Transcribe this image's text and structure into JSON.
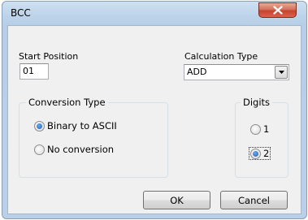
{
  "window": {
    "title": "BCC"
  },
  "start_position": {
    "label": "Start Position",
    "value": "01"
  },
  "calculation_type": {
    "label": "Calculation Type",
    "selected": "ADD"
  },
  "conversion_type": {
    "title": "Conversion Type",
    "options": [
      {
        "label": "Binary to ASCII",
        "checked": true
      },
      {
        "label": "No conversion",
        "checked": false
      }
    ]
  },
  "digits": {
    "title": "Digits",
    "options": [
      {
        "label": "1",
        "checked": false
      },
      {
        "label": "2",
        "checked": true
      }
    ]
  },
  "buttons": {
    "ok": "OK",
    "cancel": "Cancel"
  },
  "icons": {
    "close": "close-icon",
    "dropdown": "chevron-down-icon"
  },
  "colors": {
    "close_button": "#c7432c",
    "titlebar": "#bdd3ea",
    "radio_dot": "#1d5fb6"
  }
}
